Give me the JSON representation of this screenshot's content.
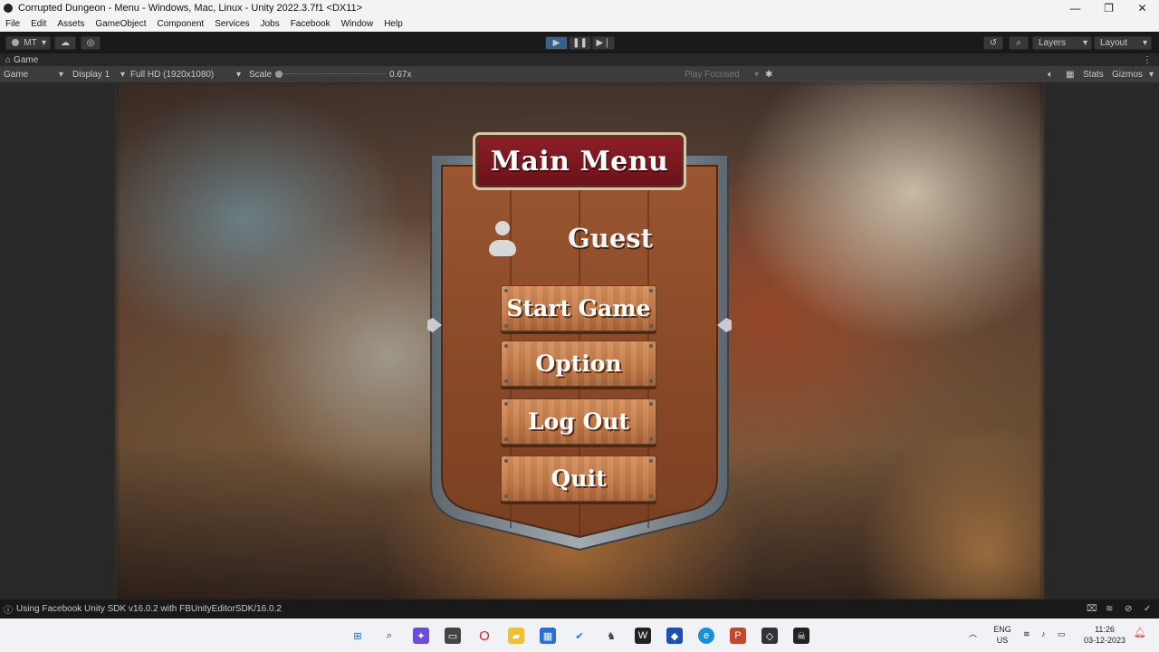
{
  "window": {
    "title": "Corrupted  Dungeon - Menu - Windows, Mac, Linux - Unity 2022.3.7f1 <DX11>",
    "minimize": "—",
    "restore": "❐",
    "close": "✕"
  },
  "menubar": [
    "File",
    "Edit",
    "Assets",
    "GameObject",
    "Component",
    "Services",
    "Jobs",
    "Facebook",
    "Window",
    "Help"
  ],
  "toolbar": {
    "account": "MT",
    "layers": "Layers",
    "layout": "Layout"
  },
  "game_view": {
    "tab_label": "Game",
    "mode": "Game",
    "display": "Display 1",
    "resolution": "Full HD (1920x1080)",
    "scale_label": "Scale",
    "scale_value": "0.67x",
    "scale_fraction": 0.0,
    "play_focused": "Play Focused",
    "stats": "Stats",
    "gizmos": "Gizmos"
  },
  "menu": {
    "title": "Main Menu",
    "user": "Guest",
    "buttons": [
      "Start Game",
      "Option",
      "Log Out",
      "Quit"
    ]
  },
  "status": {
    "message": "Using Facebook Unity SDK v16.0.2 with FBUnityEditorSDK/16.0.2"
  },
  "taskbar": {
    "lang_top": "ENG",
    "lang_bottom": "US",
    "time": "11:26",
    "date": "03-12-2023"
  },
  "colors": {
    "banner": "#8d1f27",
    "plank": "#c27a48",
    "shield_wood": "#8a4a28",
    "shield_frame": "#7d8590"
  }
}
